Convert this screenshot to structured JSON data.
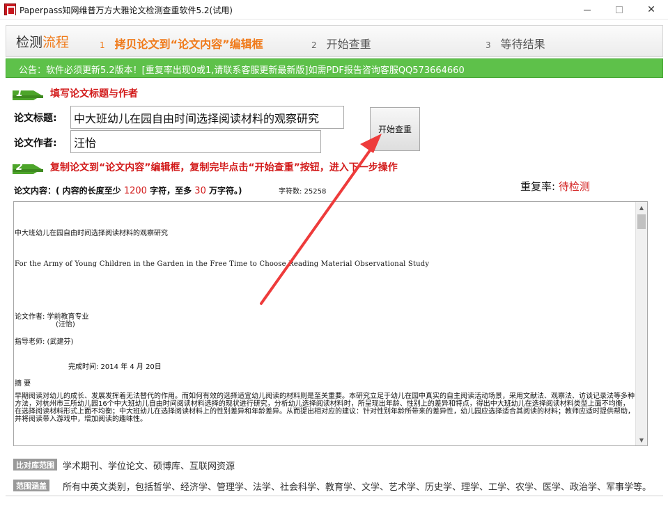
{
  "window": {
    "title": "Paperpass知网维普万方大雅论文检测查重软件5.2(试用)",
    "controls": {
      "minimize": "—",
      "maximize": "□",
      "close": "✕"
    }
  },
  "steps": {
    "head_a": "检测",
    "head_b": "流程",
    "items": [
      {
        "num": "1",
        "label": "拷贝论文到“论文内容”编辑框"
      },
      {
        "num": "2",
        "label": "开始查重"
      },
      {
        "num": "3",
        "label": "等待结果"
      }
    ]
  },
  "notice": "公告：软件必须更新5.2版本！[重复率出现0或1,请联系客服更新最新版]如需PDF报告咨询客服QQ573664660",
  "section1": {
    "badge": "1",
    "title": "填写论文标题与作者"
  },
  "section2": {
    "badge": "2",
    "title": "复制论文到“论文内容”编辑框，复制完毕点击“开始查重”按钮，进入下一步操作"
  },
  "form": {
    "title_label": "论文标题:",
    "title_value": "中大班幼儿在园自由时间选择阅读材料的观察研究",
    "author_label": "论文作者:",
    "author_value": "汪怡",
    "start_button": "开始查重"
  },
  "content": {
    "label_a": "论文内容：( 内容的长度至少 ",
    "min": "1200",
    "label_b": " 字符，至多 ",
    "max": "30",
    "label_c": " 万字符。)",
    "char_count": "字符数: 25258",
    "dup_label": "重复率: ",
    "dup_value": "待检测",
    "lines": {
      "title_cn": "中大班幼儿在园自由时间选择阅读材料的观察研究",
      "title_en": "For the Army of Young Children in the Garden in the Free Time to Choose Reading Material Observational Study",
      "author": "论文作者:   学前教育专业",
      "author_name": "(汪怡)",
      "advisor": "指导老师:    (武建芬)",
      "date": "完成时间:  2014 年 4 月 20日",
      "abstract_head": "摘    要",
      "abstract": "早期阅读对幼儿的成长、发展发挥着无法替代的作用。而如何有效的选择适宜幼儿阅读的材料则是至关重要。本研究立足于幼儿在园中真实的自主阅读活动场景，采用文献法、观察法、访谈记录法等多种方法，对杭州市三所幼儿园16个中大班幼儿自由时间阅读材料选择的现状进行研究，分析幼儿选择阅读材料时，所呈现出年龄、性别上的差异和特点，得出中大班幼儿在选择阅读材料类型上面不均衡，在选择阅读材料形式上面不均衡；中大班幼儿在选择阅读材料上的性别差异和年龄差异。从而提出相对应的建议：针对性别年龄所带来的差异性，幼儿园应选择适合其阅读的材料；教师应适时提供帮助，并将阅读带入游戏中，增加阅读的趣味性。"
    }
  },
  "footer": {
    "badge1": "比对库范围",
    "text1": "学术期刊、学位论文、硕博库、互联网资源",
    "badge2": "范围涵盖",
    "text2": "所有中英文类别，包括哲学、经济学、管理学、法学、社会科学、教育学、文学、艺术学、历史学、理学、工学、农学、医学、政治学、军事学等。"
  },
  "colors": {
    "accent_orange": "#f07a1a",
    "notice_green": "#5ec14a",
    "badge_green": "#4da52a",
    "warning_red": "#d21a1a",
    "arrow_red": "#ee3b3b"
  }
}
